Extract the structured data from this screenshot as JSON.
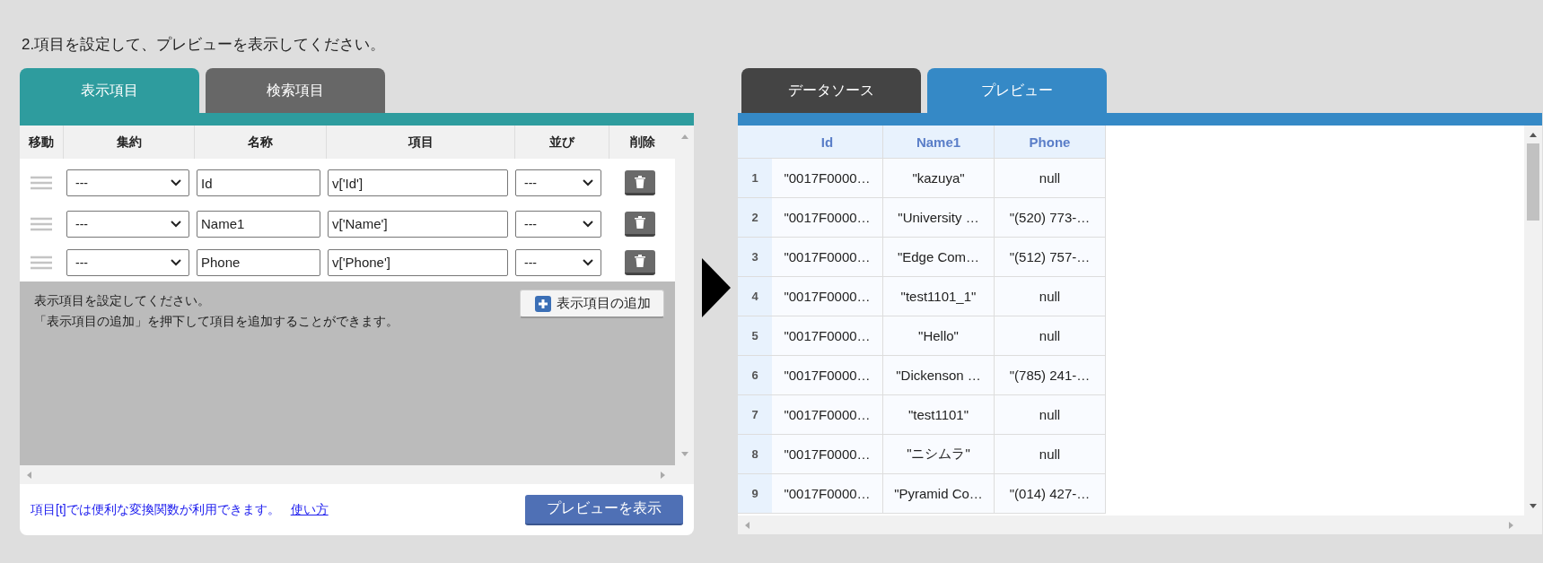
{
  "instruction": "2.項目を設定して、プレビューを表示してください。",
  "left_tabs": [
    {
      "label": "表示項目",
      "selected": true
    },
    {
      "label": "検索項目",
      "selected": false
    }
  ],
  "field_table": {
    "columns": [
      "移動",
      "集約",
      "名称",
      "項目",
      "並び",
      "削除"
    ],
    "rows": [
      {
        "aggregate": "---",
        "name": "Id",
        "expression": "v['Id']",
        "order": "---"
      },
      {
        "aggregate": "---",
        "name": "Name1",
        "expression": "v['Name']",
        "order": "---"
      },
      {
        "aggregate": "---",
        "name": "Phone",
        "expression": "v['Phone']",
        "order": "---"
      }
    ]
  },
  "hint": [
    "表示項目を設定してください。",
    "「表示項目の追加」を押下して項目を追加することができます。"
  ],
  "add_button": "表示項目の追加",
  "footer": {
    "note": "項目[t]では便利な変換関数が利用できます。",
    "link": "使い方",
    "preview_button": "プレビューを表示"
  },
  "right_tabs": [
    {
      "label": "データソース",
      "selected": false
    },
    {
      "label": "プレビュー",
      "selected": true
    }
  ],
  "preview_table": {
    "columns": [
      "Id",
      "Name1",
      "Phone"
    ],
    "rows": [
      {
        "number": "1",
        "cells": [
          "\"0017F0000…",
          "\"kazuya\"",
          "null"
        ]
      },
      {
        "number": "2",
        "cells": [
          "\"0017F0000…",
          "\"University …",
          "\"(520) 773-…"
        ]
      },
      {
        "number": "3",
        "cells": [
          "\"0017F0000…",
          "\"Edge Com…",
          "\"(512) 757-…"
        ]
      },
      {
        "number": "4",
        "cells": [
          "\"0017F0000…",
          "\"test1101_1\"",
          "null"
        ]
      },
      {
        "number": "5",
        "cells": [
          "\"0017F0000…",
          "\"Hello\"",
          "null"
        ]
      },
      {
        "number": "6",
        "cells": [
          "\"0017F0000…",
          "\"Dickenson …",
          "\"(785) 241-…"
        ]
      },
      {
        "number": "7",
        "cells": [
          "\"0017F0000…",
          "\"test1101\"",
          "null"
        ]
      },
      {
        "number": "8",
        "cells": [
          "\"0017F0000…",
          "\"ニシムラ\"",
          "null"
        ]
      },
      {
        "number": "9",
        "cells": [
          "\"0017F0000…",
          "\"Pyramid Co…",
          "\"(014) 427-…"
        ]
      }
    ]
  }
}
